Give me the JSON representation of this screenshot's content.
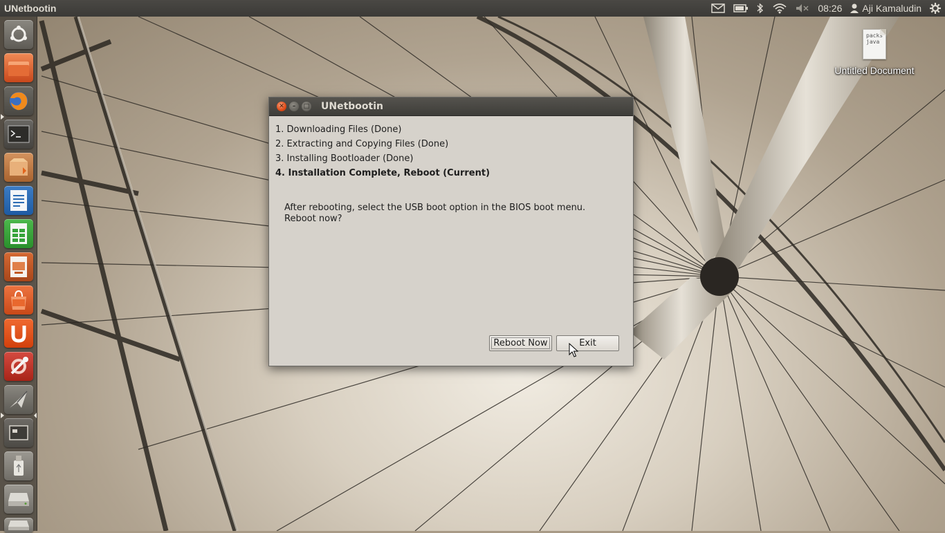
{
  "top_panel": {
    "app_title": "UNetbootin",
    "time": "08:26",
    "user": "Aji Kamaludin",
    "icons": [
      "mail-icon",
      "battery-icon",
      "bluetooth-icon",
      "wifi-icon",
      "volume-muted-icon",
      "user-icon",
      "gear-icon"
    ]
  },
  "launcher": {
    "items": [
      {
        "name": "dash-home",
        "icon": "ubuntu-logo-icon",
        "color": "#6e6a63"
      },
      {
        "name": "files",
        "icon": "folder-icon",
        "color": "#e06a3a"
      },
      {
        "name": "firefox",
        "icon": "firefox-icon",
        "color": "#5a5852"
      },
      {
        "name": "terminal",
        "icon": "terminal-icon",
        "color": "#5c5a56"
      },
      {
        "name": "archive-manager",
        "icon": "package-icon",
        "color": "#c27a47"
      },
      {
        "name": "libreoffice-writer",
        "icon": "writer-icon",
        "color": "#2a6bb3"
      },
      {
        "name": "libreoffice-calc",
        "icon": "calc-icon",
        "color": "#36a43a"
      },
      {
        "name": "libreoffice-impress",
        "icon": "impress-icon",
        "color": "#c25a22"
      },
      {
        "name": "software-center",
        "icon": "shopping-bag-icon",
        "color": "#de5a24"
      },
      {
        "name": "ubuntu-one",
        "icon": "ubuntu-one-icon",
        "color": "#dd4814"
      },
      {
        "name": "system-settings",
        "icon": "settings-wrench-icon",
        "color": "#c8302a"
      },
      {
        "name": "unetbootin",
        "icon": "unetbootin-icon",
        "color": "#7a7770"
      },
      {
        "name": "workspace-switcher",
        "icon": "workspace-icon",
        "color": "#6a6762"
      },
      {
        "name": "usb-drive",
        "icon": "usb-icon",
        "color": "#8a8780"
      },
      {
        "name": "disk-drive",
        "icon": "harddisk-icon",
        "color": "#8a8780"
      },
      {
        "name": "disk-drive-2",
        "icon": "harddisk-icon",
        "color": "#8a8780"
      }
    ]
  },
  "desktop": {
    "file_label": "Untitled Document",
    "file_preview": "packs\njava"
  },
  "window": {
    "title": "UNetbootin",
    "steps": [
      "1. Downloading Files (Done)",
      "2. Extracting and Copying Files (Done)",
      "3. Installing Bootloader (Done)",
      "4. Installation Complete, Reboot (Current)"
    ],
    "current_step": 4,
    "message_line1": "After rebooting, select the USB boot option in the BIOS boot menu.",
    "message_line2": "Reboot now?",
    "reboot_label": "Reboot Now",
    "exit_label": "Exit"
  }
}
